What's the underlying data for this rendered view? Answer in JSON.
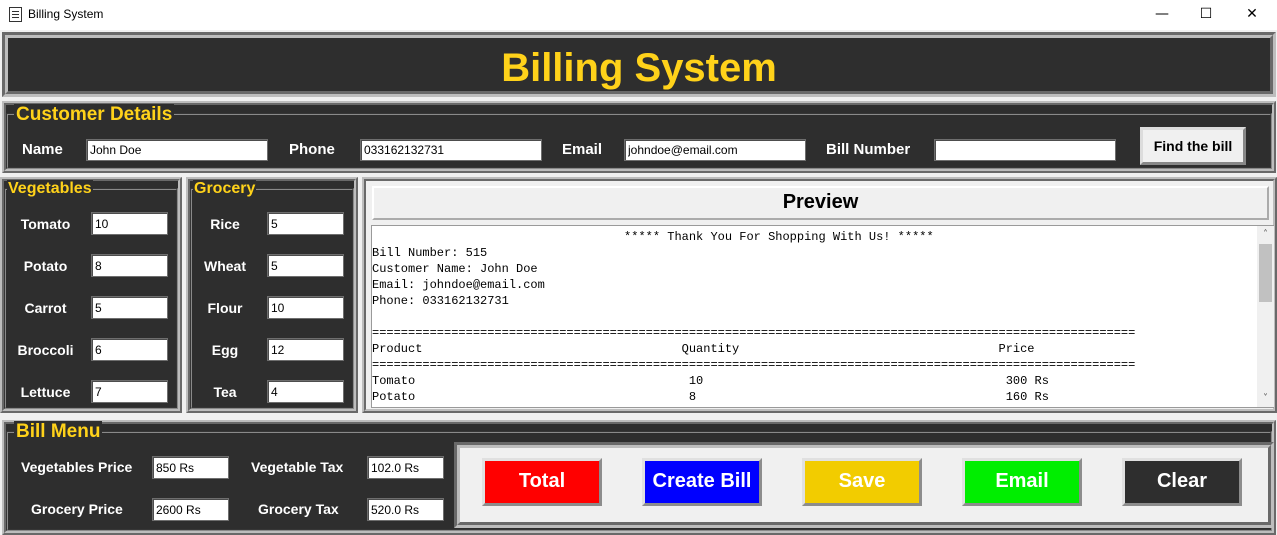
{
  "window": {
    "title": "Billing System",
    "minimize": "—",
    "maximize": "☐",
    "close": "✕"
  },
  "header": {
    "title": "Billing System"
  },
  "customer": {
    "legend": "Customer Details",
    "name_label": "Name",
    "name_value": "John Doe",
    "phone_label": "Phone",
    "phone_value": "033162132731",
    "email_label": "Email",
    "email_value": "johndoe@email.com",
    "bill_label": "Bill Number",
    "bill_value": "",
    "find_button": "Find the bill"
  },
  "vegetables": {
    "legend": "Vegetables",
    "items": [
      {
        "label": "Tomato",
        "value": "10"
      },
      {
        "label": "Potato",
        "value": "8"
      },
      {
        "label": "Carrot",
        "value": "5"
      },
      {
        "label": "Broccoli",
        "value": "6"
      },
      {
        "label": "Lettuce",
        "value": "7"
      }
    ]
  },
  "grocery": {
    "legend": "Grocery",
    "items": [
      {
        "label": "Rice",
        "value": "5"
      },
      {
        "label": "Wheat",
        "value": "5"
      },
      {
        "label": "Flour",
        "value": "10"
      },
      {
        "label": "Egg",
        "value": "12"
      },
      {
        "label": "Tea",
        "value": "4"
      }
    ]
  },
  "preview": {
    "title": "Preview",
    "text": "                                   ***** Thank You For Shopping With Us! *****\nBill Number: 515\nCustomer Name: John Doe\nEmail: johndoe@email.com\nPhone: 033162132731\n\n==========================================================================================================\nProduct                                    Quantity                                    Price\n==========================================================================================================\nTomato                                      10                                          300 Rs\nPotato                                      8                                           160 Rs"
  },
  "bill_menu": {
    "legend": "Bill Menu",
    "veg_price_label": "Vegetables Price",
    "veg_price_value": "850 Rs",
    "veg_tax_label": "Vegetable Tax",
    "veg_tax_value": "102.0 Rs",
    "grocery_price_label": "Grocery Price",
    "grocery_price_value": "2600 Rs",
    "grocery_tax_label": "Grocery Tax",
    "grocery_tax_value": "520.0 Rs"
  },
  "buttons": {
    "total": "Total",
    "create": "Create Bill",
    "save": "Save",
    "email": "Email",
    "clear": "Clear"
  },
  "colors": {
    "panel": "#2e2e2e",
    "accent": "#ffd21a",
    "total": "#ff0000",
    "create": "#0000ff",
    "save": "#ffcc00",
    "email": "#00ee00",
    "clear": "#2e2e2e"
  }
}
